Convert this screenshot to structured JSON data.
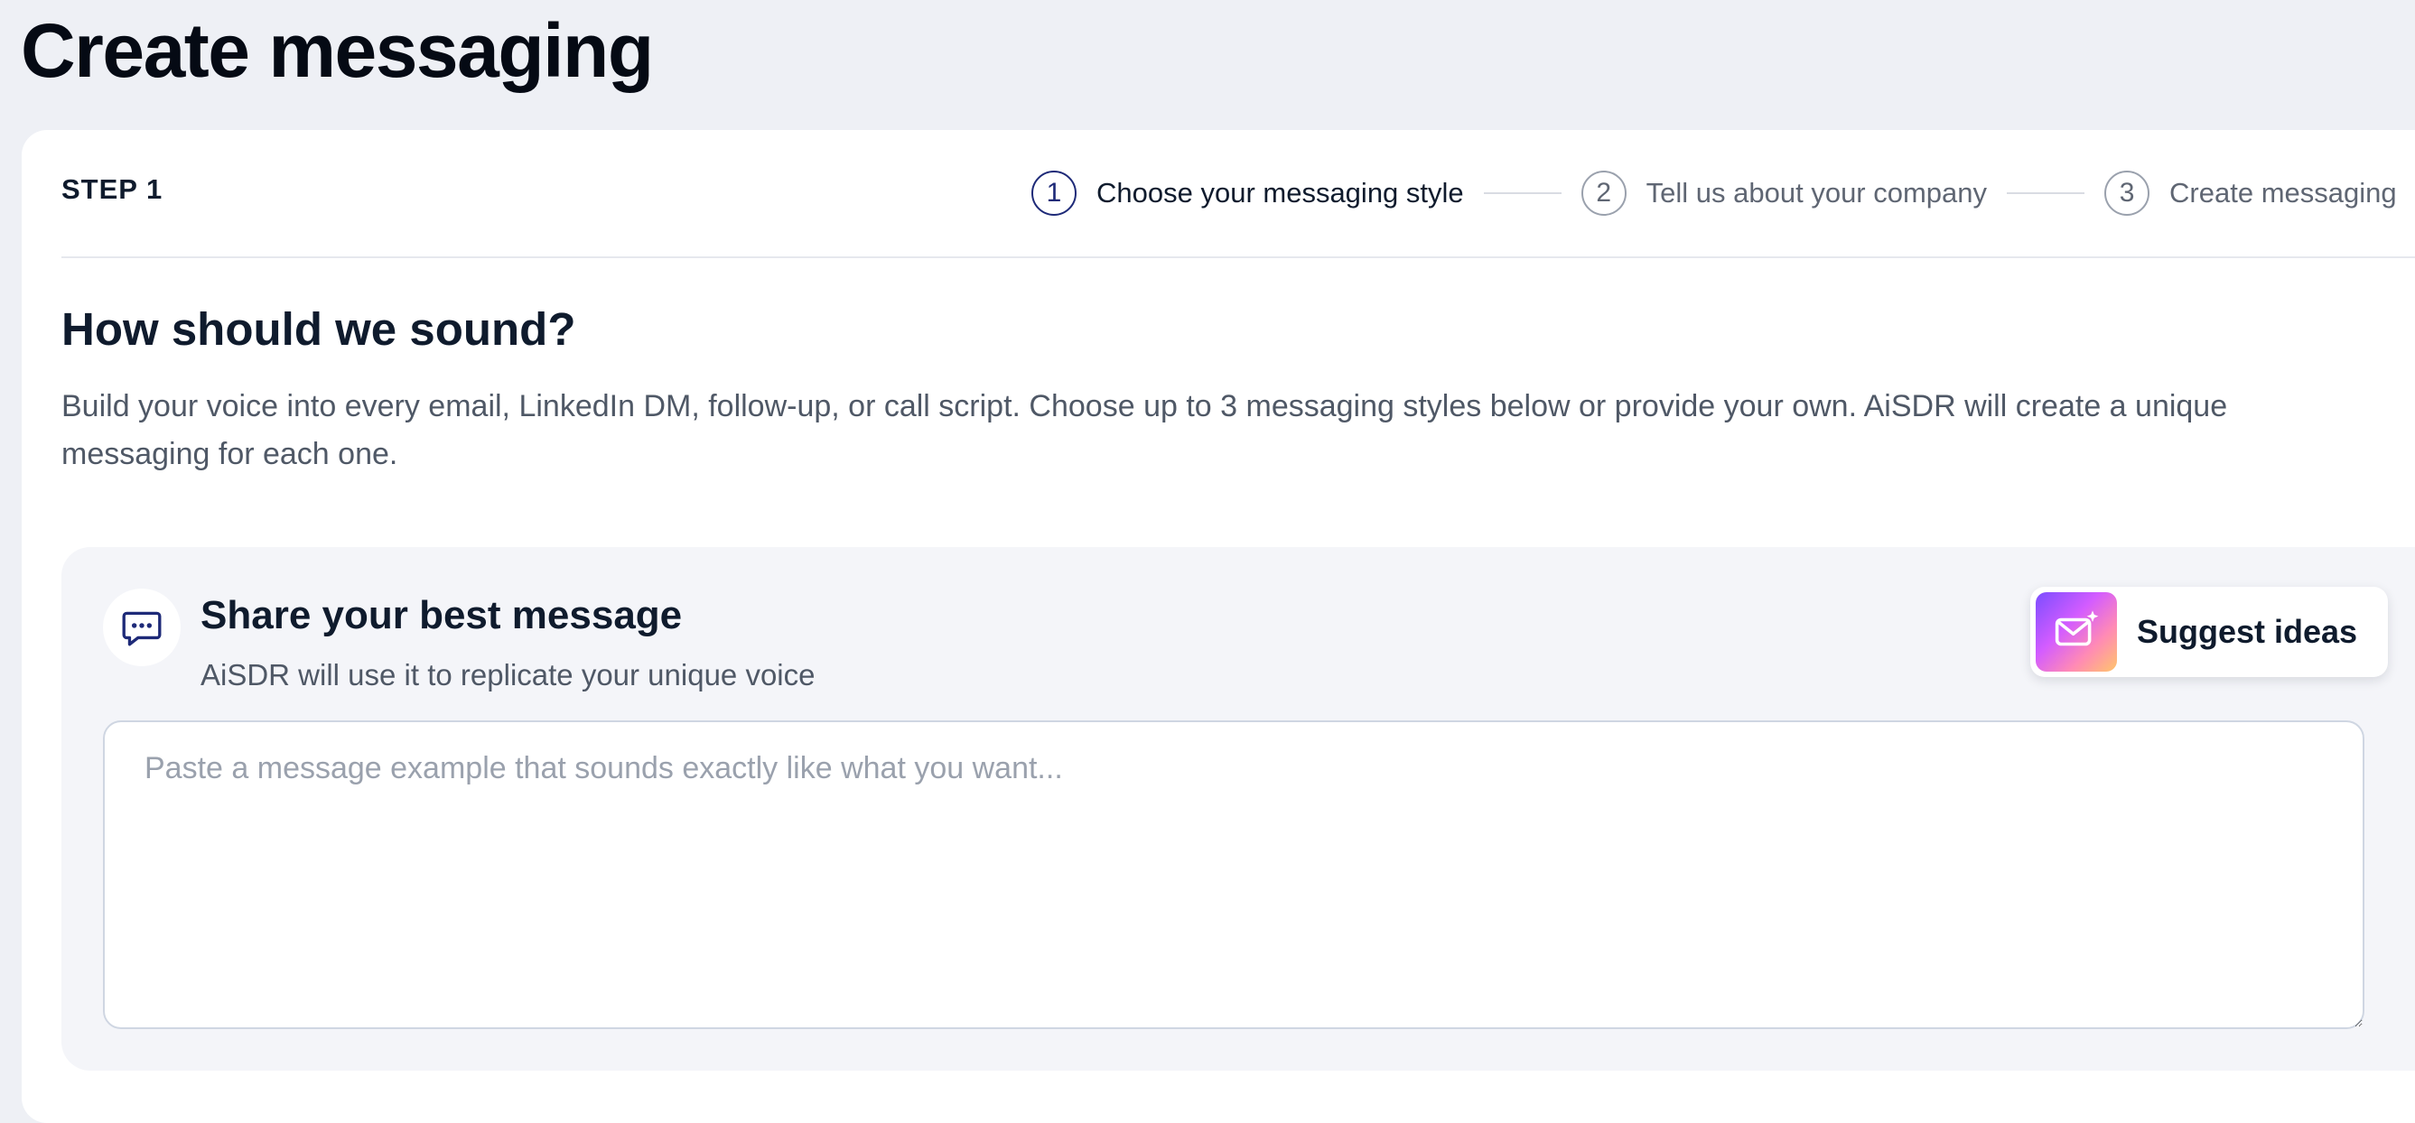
{
  "page": {
    "title": "Create messaging"
  },
  "header": {
    "step_label": "STEP 1",
    "steps": [
      {
        "number": "1",
        "label": "Choose your messaging style",
        "active": true
      },
      {
        "number": "2",
        "label": "Tell us about your company",
        "active": false
      },
      {
        "number": "3",
        "label": "Create messaging",
        "active": false
      }
    ]
  },
  "section": {
    "heading": "How should we sound?",
    "description": "Build your voice into every email, LinkedIn DM, follow-up, or call script. Choose up to 3 messaging styles below or provide your own. AiSDR will create a unique messaging for each one."
  },
  "panel": {
    "icon": "chat-bubble-icon",
    "title": "Share your best message",
    "subtitle": "AiSDR will use it to replicate your unique voice",
    "suggest_button": {
      "label": "Suggest ideas",
      "icon": "envelope-sparkle-icon"
    },
    "textarea": {
      "value": "",
      "placeholder": "Paste a message example that sounds exactly like what you want..."
    }
  },
  "colors": {
    "page_background": "#eef0f5",
    "card_background": "#ffffff",
    "panel_background": "#f4f5f9",
    "active_step": "#1e2a78",
    "text_primary": "#0f1b2d",
    "text_secondary": "#4f5866"
  }
}
